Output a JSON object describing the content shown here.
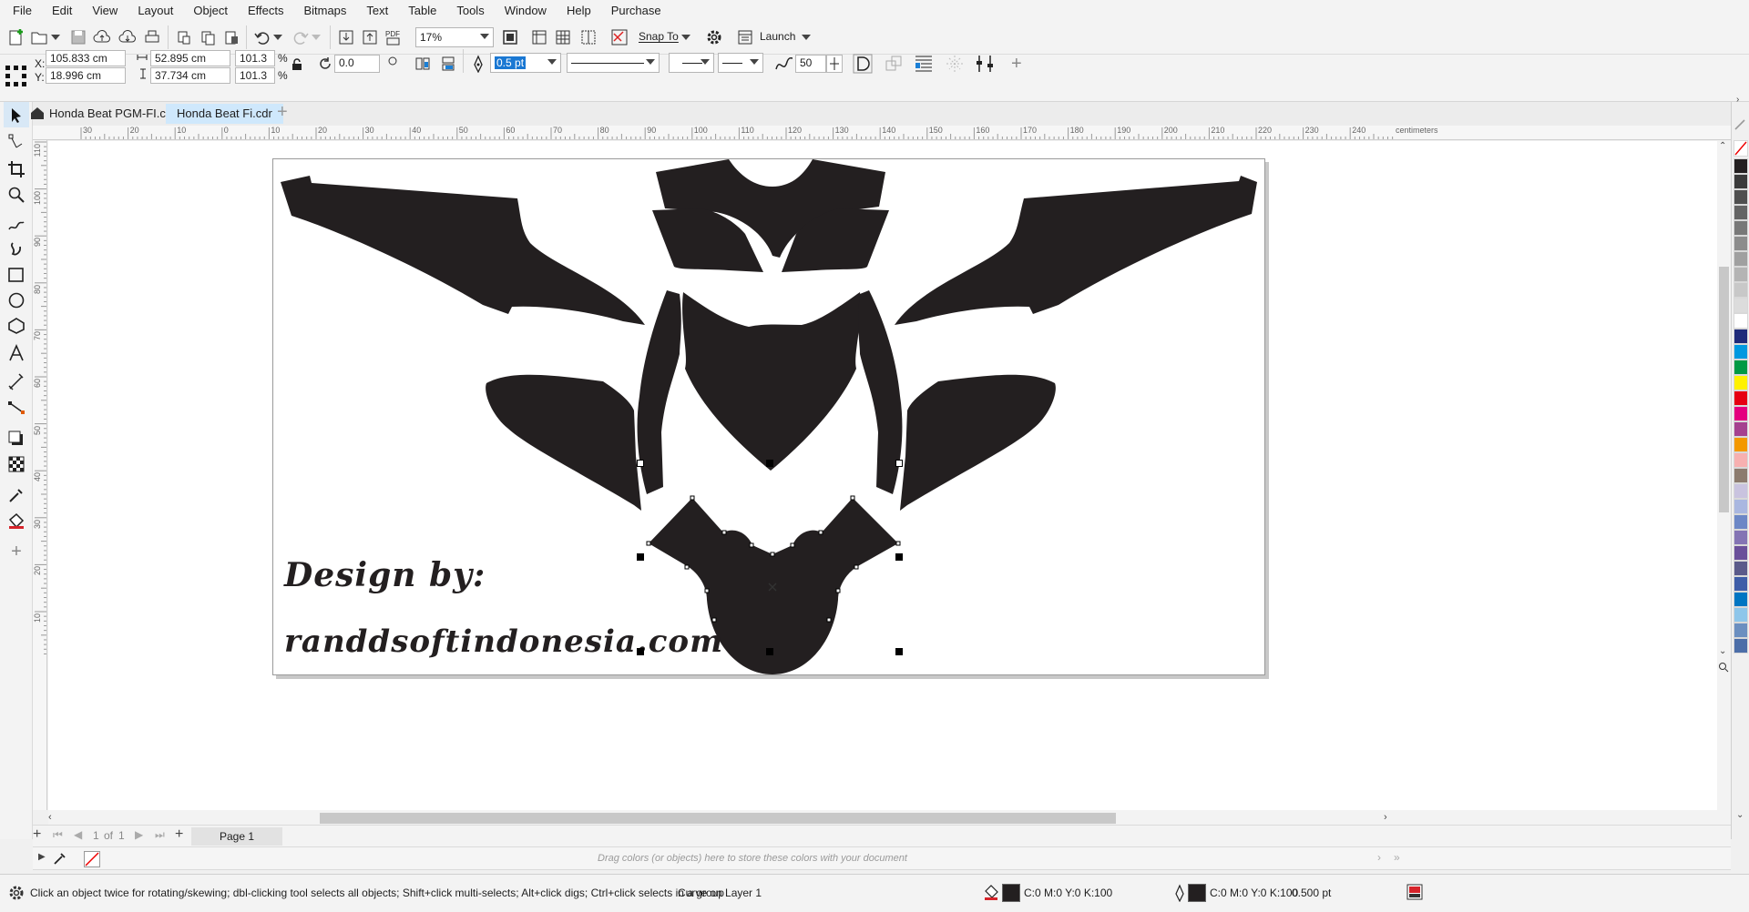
{
  "menu": [
    "File",
    "Edit",
    "View",
    "Layout",
    "Object",
    "Effects",
    "Bitmaps",
    "Text",
    "Table",
    "Tools",
    "Window",
    "Help",
    "Purchase"
  ],
  "toolbar": {
    "zoom_value": "17%",
    "snap_label": "Snap To",
    "launch_label": "Launch"
  },
  "propbar": {
    "x_label": "X:",
    "y_label": "Y:",
    "x_value": "105.833 cm",
    "y_value": "18.996 cm",
    "width_value": "52.895 cm",
    "height_value": "37.734 cm",
    "scale_w": "101.3",
    "scale_h": "101.3",
    "percent": "%",
    "rotation": "0.0",
    "outline_width": "0.5 pt",
    "smoothing": "50"
  },
  "tabs": [
    {
      "label": "Honda Beat PGM-FI.cdr"
    },
    {
      "label": "Honda Beat Fi.cdr"
    }
  ],
  "ruler": {
    "unit": "centimeters",
    "h_ticks": [
      "30",
      "20",
      "10",
      "0",
      "10",
      "20",
      "30",
      "40",
      "50",
      "60",
      "70",
      "80",
      "90",
      "100",
      "110",
      "120",
      "130",
      "140",
      "150",
      "160",
      "170",
      "180",
      "190",
      "200",
      "210",
      "220",
      "230",
      "240"
    ],
    "v_ticks": [
      "110",
      "100",
      "90",
      "80",
      "70",
      "60",
      "50",
      "40",
      "30",
      "20",
      "10"
    ]
  },
  "canvas": {
    "design_by": "Design by:",
    "website": "randdsoftindonesia.com"
  },
  "pagenav": {
    "current": "1",
    "of_label": "of",
    "total": "1",
    "page_tab": "Page 1"
  },
  "docpalette_hint": "Drag colors (or objects) here to store these colors with your document",
  "status": {
    "hint": "Click an object twice for rotating/skewing; dbl-clicking tool selects all objects; Shift+click multi-selects; Alt+click digs; Ctrl+click selects in a group",
    "object_info": "Curve on Layer 1",
    "fill_value": "C:0 M:0 Y:0 K:100",
    "outline_value": "C:0 M:0 Y:0 K:100",
    "outline_width": "0.500 pt"
  },
  "colors": {
    "shape_fill": "#231f20",
    "accent": "#cfe8fc",
    "palette": [
      "#231f20",
      "#3a3a3a",
      "#4f4f4f",
      "#646464",
      "#787878",
      "#8c8c8c",
      "#a0a0a0",
      "#b4b4b4",
      "#c8c8c8",
      "#dcdcdc",
      "#ffffff",
      "#1f2a7a",
      "#0099e0",
      "#009944",
      "#fff100",
      "#e60012",
      "#e4007f",
      "#a5418f",
      "#f39800",
      "#f7b0b0",
      "#8c7b6e",
      "#c9c3df",
      "#a9b7e0",
      "#6c87c6",
      "#8474b4",
      "#6a4f9a",
      "#5a5a8a",
      "#3e5da8",
      "#0075c2",
      "#8ec6ea",
      "#6b8fc0",
      "#4c6ea8"
    ]
  }
}
